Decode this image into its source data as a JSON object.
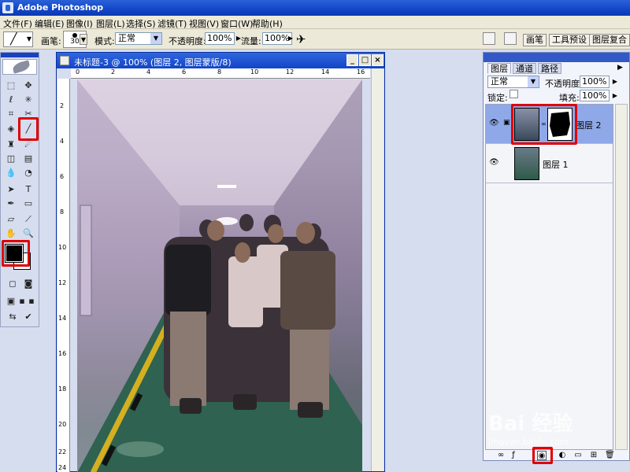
{
  "app": {
    "title": "Adobe Photoshop"
  },
  "menu": [
    "文件(F)",
    "编辑(E)",
    "图像(I)",
    "图层(L)",
    "选择(S)",
    "滤镜(T)",
    "视图(V)",
    "窗口(W)",
    "帮助(H)"
  ],
  "options": {
    "brush_label": "画笔:",
    "brush_size": "30",
    "mode_label": "模式:",
    "mode_value": "正常",
    "opacity_label": "不透明度:",
    "opacity_value": "100%",
    "flow_label": "流量:",
    "flow_value": "100%",
    "well_tabs": [
      "画笔",
      "工具预设",
      "图层复合"
    ]
  },
  "document": {
    "title": "未标题-3 @ 100% (图层 2, 图层蒙版/8)",
    "ruler_h": [
      "0",
      "2",
      "4",
      "6",
      "8",
      "10",
      "12",
      "14",
      "16"
    ],
    "ruler_v": [
      "2",
      "4",
      "6",
      "8",
      "10",
      "12",
      "14",
      "16",
      "18",
      "20",
      "22",
      "24"
    ]
  },
  "layers_palette": {
    "tabs": [
      "图层",
      "通道",
      "路径"
    ],
    "blend_mode": "正常",
    "opacity_label": "不透明度:",
    "opacity_value": "100%",
    "lock_label": "锁定:",
    "fill_label": "填充:",
    "fill_value": "100%",
    "layers": [
      {
        "name": "图层 2",
        "selected": true,
        "has_mask": true
      },
      {
        "name": "图层 1",
        "selected": false,
        "has_mask": false
      }
    ]
  },
  "watermark": {
    "brand": "Bai 经验",
    "url": "jingyan.baidu.com"
  },
  "colors": {
    "title_blue": "#1245c8",
    "highlight_red": "#e00000",
    "selected_layer": "#8fa8e8"
  }
}
